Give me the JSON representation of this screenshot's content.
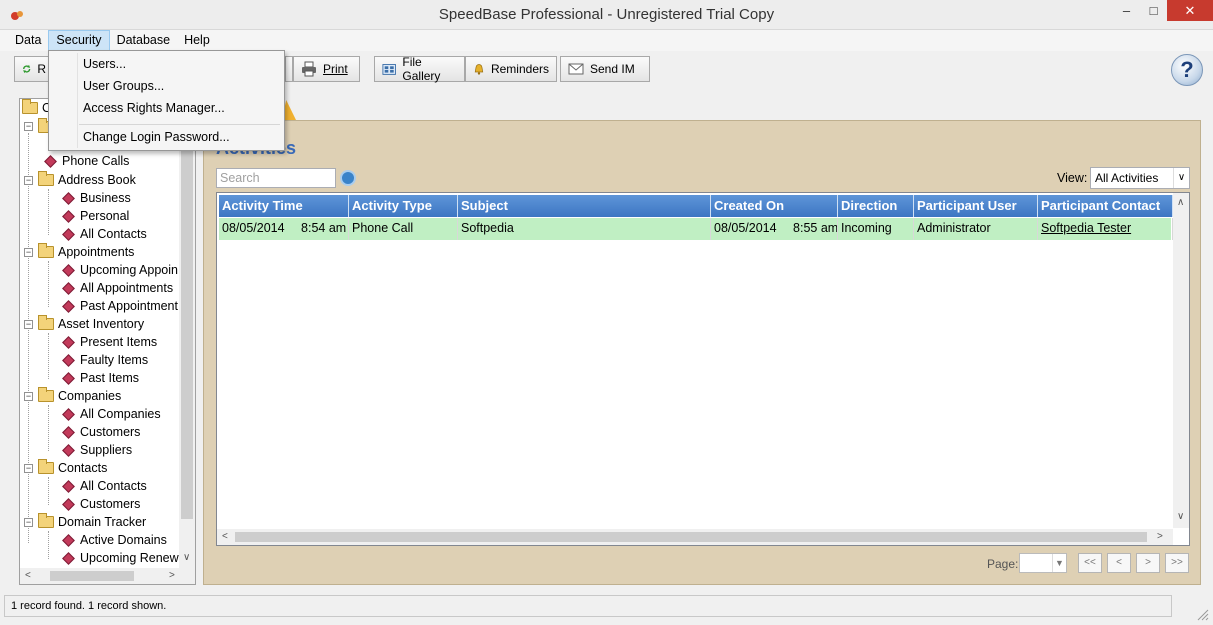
{
  "window": {
    "title": "SpeedBase Professional - Unregistered Trial Copy",
    "controls": [
      "–",
      "□",
      "✕"
    ]
  },
  "menubar": {
    "items": [
      "Data",
      "Security",
      "Database",
      "Help"
    ],
    "active": "Security"
  },
  "security_menu": {
    "items": [
      "Users...",
      "User Groups...",
      "Access Rights Manager...",
      "Change Login Password..."
    ]
  },
  "toolbar": {
    "refresh_partial": "R",
    "print": "Print",
    "file_gallery": "File Gallery",
    "reminders": "Reminders",
    "send_im": "Send IM",
    "help": "?"
  },
  "tree": {
    "root_partial": "C",
    "items": [
      {
        "label": "Phone Calls"
      },
      {
        "label": "Address Book"
      },
      {
        "label": "Business"
      },
      {
        "label": "Personal"
      },
      {
        "label": "All Contacts"
      },
      {
        "label": "Appointments"
      },
      {
        "label": "Upcoming Appoin"
      },
      {
        "label": "All Appointments"
      },
      {
        "label": "Past Appointment"
      },
      {
        "label": "Asset Inventory"
      },
      {
        "label": "Present Items"
      },
      {
        "label": "Faulty Items"
      },
      {
        "label": "Past Items"
      },
      {
        "label": "Companies"
      },
      {
        "label": "All Companies"
      },
      {
        "label": "Customers"
      },
      {
        "label": "Suppliers"
      },
      {
        "label": "Contacts"
      },
      {
        "label": "All Contacts"
      },
      {
        "label": "Customers"
      },
      {
        "label": "Domain Tracker"
      },
      {
        "label": "Active Domains"
      },
      {
        "label": "Upcoming Renew"
      }
    ]
  },
  "panel": {
    "title": "Activities",
    "search_placeholder": "Search",
    "view_label": "View:",
    "view_value": "All Activities"
  },
  "grid": {
    "columns": [
      "Activity Time",
      "Activity Type",
      "Subject",
      "Created On",
      "Direction",
      "Participant User",
      "Participant Contact"
    ],
    "rows": [
      {
        "activity_date": "08/05/2014",
        "activity_time": "8:54 am",
        "activity_type": "Phone Call",
        "subject": "Softpedia",
        "created_date": "08/05/2014",
        "created_time": "8:55 am",
        "direction": "Incoming",
        "participant_user": "Administrator",
        "participant_contact": "Softpedia Tester"
      }
    ]
  },
  "pager": {
    "label": "Page:",
    "first": "<<",
    "prev": "<",
    "next": ">",
    "last": ">>"
  },
  "status": {
    "text": "1 record found. 1 record shown."
  }
}
